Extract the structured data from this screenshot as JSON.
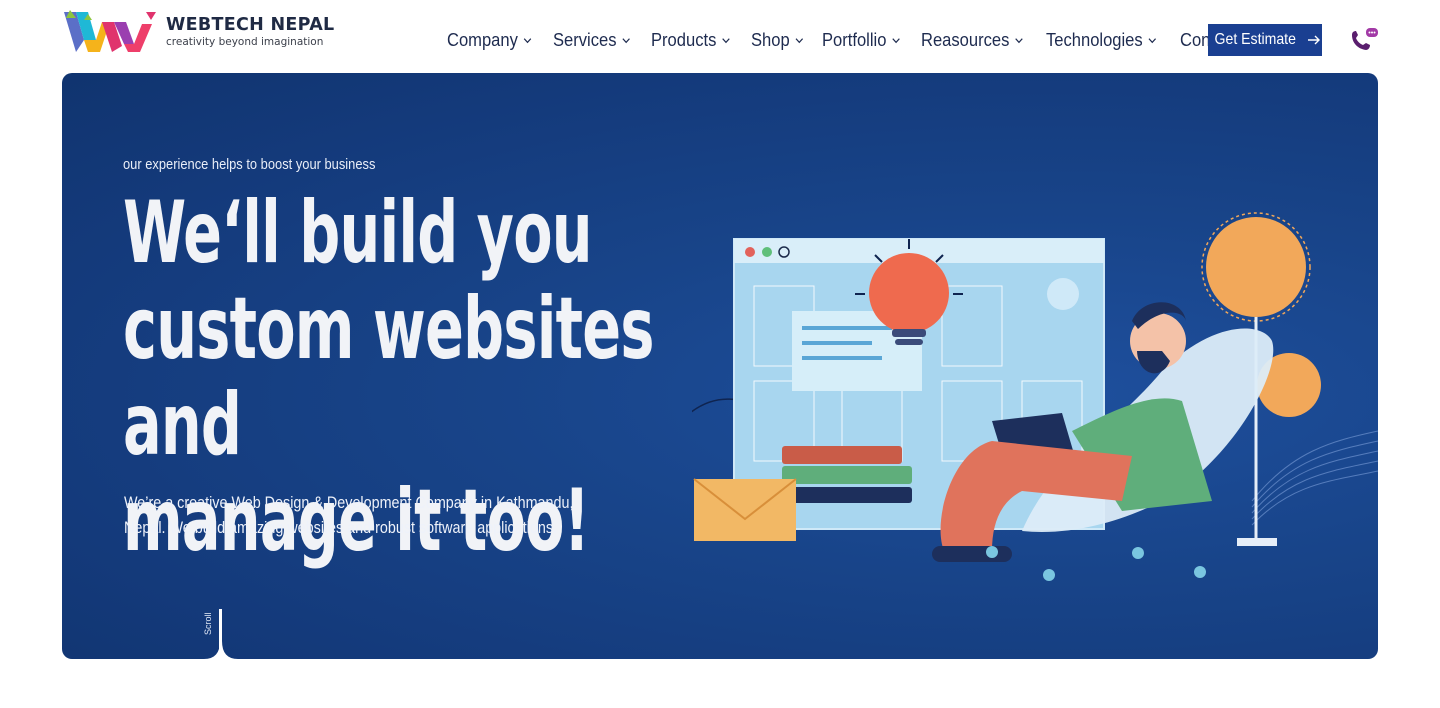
{
  "brand": {
    "name": "WEBTECH NEPAL",
    "tagline": "creativity beyond imagination",
    "logo_icon": "webtech-w-logo-icon"
  },
  "nav": {
    "items": [
      {
        "label": "Company",
        "icon": "chevron-down-icon"
      },
      {
        "label": "Services",
        "icon": "chevron-down-icon"
      },
      {
        "label": "Products",
        "icon": "chevron-down-icon"
      },
      {
        "label": "Shop",
        "icon": "chevron-down-icon"
      },
      {
        "label": "Portfollio",
        "icon": "chevron-down-icon"
      },
      {
        "label": "Reasources",
        "icon": "chevron-down-icon"
      },
      {
        "label": "Technologies",
        "icon": "chevron-down-icon"
      },
      {
        "label": "Contact",
        "icon": "chevron-down-icon"
      }
    ],
    "cta_label": "Get Estimate",
    "cta_icon": "arrow-right-icon",
    "phone_icon": "phone-chat-icon"
  },
  "hero": {
    "eyebrow": "our experience helps to boost your business",
    "headline_lines": [
      "We‘ll build you",
      "custom websites and",
      "manage it too!"
    ],
    "description": "We’re a creative Web Design & Development Company in Kathmandu, Nepal. We build amazing websites and robust software applications.",
    "scroll_label": "Scroll",
    "illustration": "developer-with-laptop-illustration"
  },
  "colors": {
    "hero_bg": "#184489",
    "cta_bg": "#1a3f91",
    "nav_text": "#1e2b4f",
    "accent_orange": "#f2a65a"
  }
}
